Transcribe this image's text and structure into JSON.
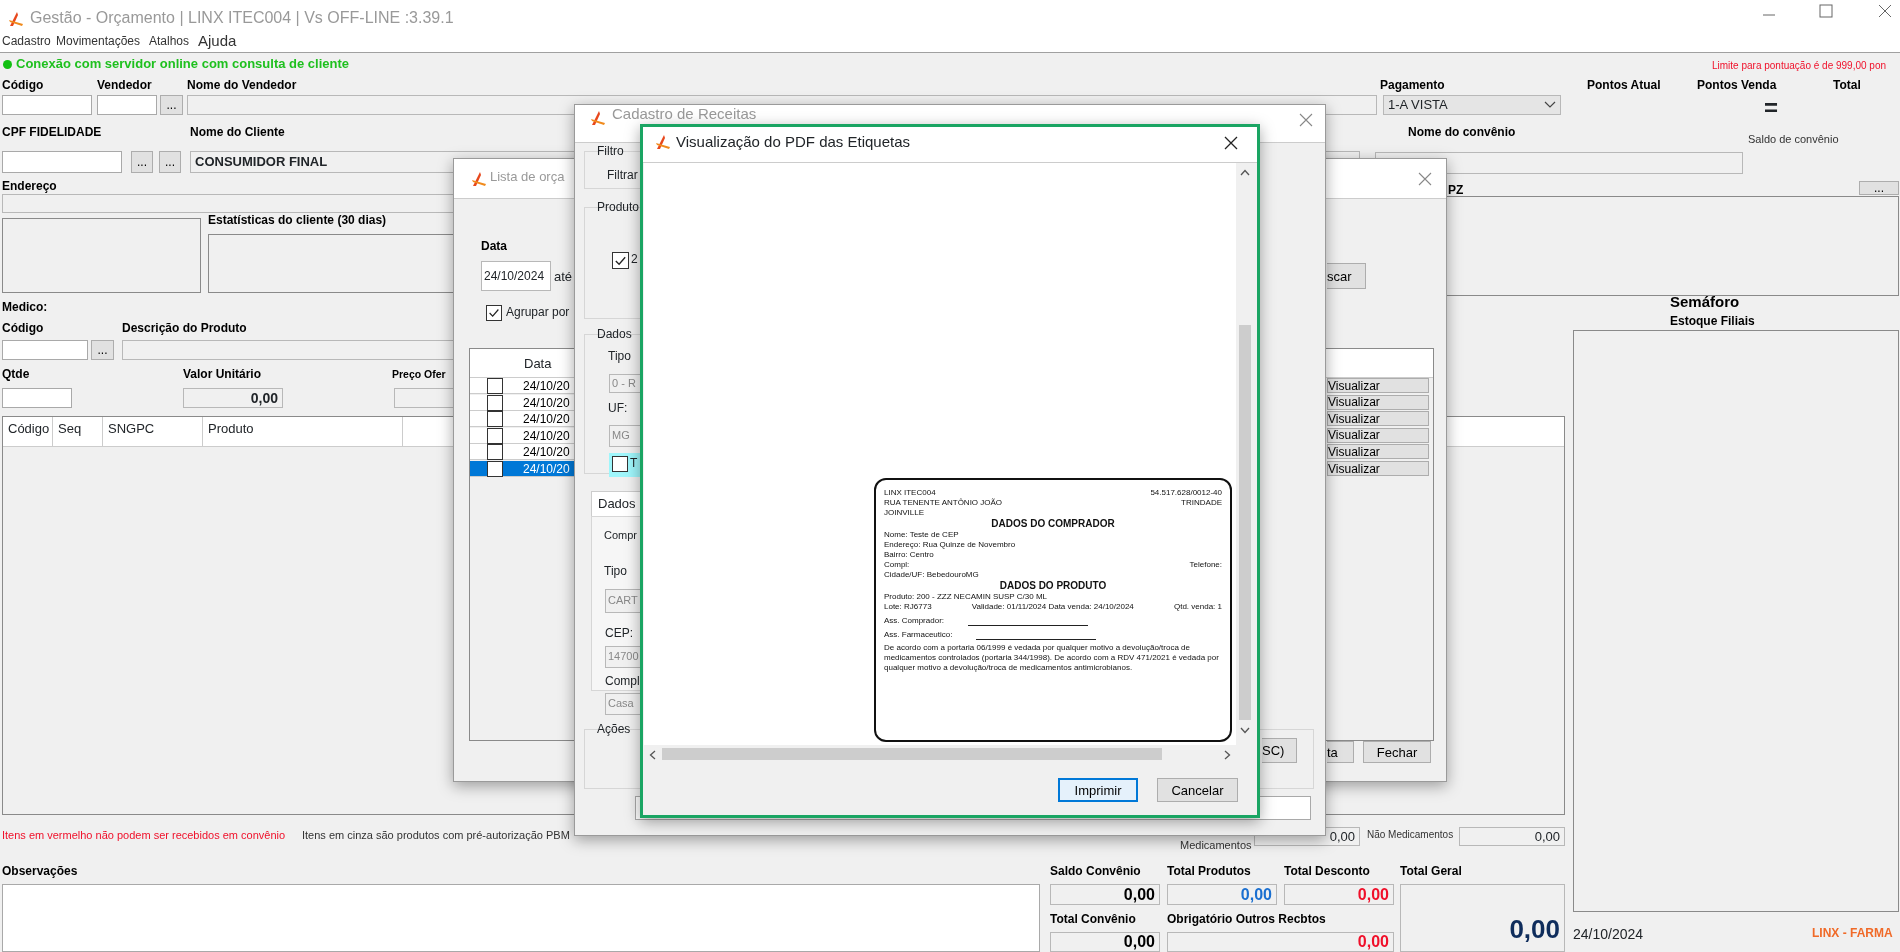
{
  "window": {
    "title": "Gestão - Orçamento  | LINX ITEC004 | Vs OFF-LINE :3.39.1"
  },
  "menu": [
    "Cadastro",
    "Movimentações",
    "Atalhos",
    "Ajuda"
  ],
  "connection_status": {
    "text": "Conexão com servidor online com consulta de cliente",
    "online": true
  },
  "points_limit": "Limite para pontuação é de 999,00 pon",
  "form": {
    "items": [
      {
        "kind": "label",
        "text": "Código"
      },
      {
        "kind": "label",
        "text": "Vendedor"
      },
      {
        "kind": "label",
        "text": "Nome do Vendedor"
      },
      {
        "kind": "label",
        "text": "Pagamento"
      },
      {
        "kind": "label",
        "text": "Pontos Atual"
      },
      {
        "kind": "label",
        "text": "Pontos Venda"
      },
      {
        "kind": "label",
        "text": "Total"
      },
      {
        "kind": "field"
      },
      {
        "kind": "field"
      },
      {
        "kind": "button",
        "text": "..."
      },
      {
        "kind": "readonly-field"
      },
      {
        "kind": "select",
        "text": "1-A VISTA"
      },
      {
        "kind": "sign",
        "text": "="
      },
      {
        "kind": "label",
        "text": "CPF FIDELIDADE"
      },
      {
        "kind": "label",
        "text": "Nome do Cliente"
      },
      {
        "kind": "label",
        "text": "Nome do convênio"
      },
      {
        "kind": "note",
        "text": "Saldo de convênio"
      },
      {
        "kind": "field"
      },
      {
        "kind": "button",
        "text": "..."
      },
      {
        "kind": "button",
        "text": "..."
      },
      {
        "kind": "name-field",
        "text": "CONSUMIDOR FINAL"
      },
      {
        "kind": "readonly-field"
      },
      {
        "kind": "label",
        "text": "Endereço"
      },
      {
        "kind": "readonly-field"
      },
      {
        "kind": "label",
        "text": "PZ"
      },
      {
        "kind": "button",
        "text": "..."
      },
      {
        "kind": "box"
      },
      {
        "kind": "label",
        "text": "Estatísticas do cliente  (30 dias)"
      },
      {
        "kind": "box"
      },
      {
        "kind": "box"
      },
      {
        "kind": "label",
        "text": "Medico:"
      },
      {
        "kind": "label",
        "text": "Código"
      },
      {
        "kind": "label",
        "text": "Descrição do Produto"
      },
      {
        "kind": "field"
      },
      {
        "kind": "button",
        "text": "..."
      },
      {
        "kind": "readonly-field"
      },
      {
        "kind": "label",
        "text": "Qtde"
      },
      {
        "kind": "label",
        "text": "Valor Unitário"
      },
      {
        "kind": "label",
        "text": "Preço Ofer"
      },
      {
        "kind": "field"
      },
      {
        "kind": "amount-field",
        "text": "0,00"
      },
      {
        "kind": "readonly-field"
      },
      {
        "kind": "heading",
        "text": "Semáforo"
      },
      {
        "kind": "label",
        "text": "Estoque Filiais"
      },
      {
        "kind": "box"
      },
      {
        "kind": "warning",
        "text": "Itens em vermelho não podem ser recebidos em convênio"
      },
      {
        "kind": "note",
        "text": "Itens em cinza são produtos com pré-autorização PBM"
      },
      {
        "kind": "note",
        "text": "Medicamentos"
      },
      {
        "kind": "number-field",
        "text": "0,00"
      },
      {
        "kind": "note",
        "text": "Não Medicamentos"
      },
      {
        "kind": "number-field",
        "text": "0,00"
      },
      {
        "kind": "label",
        "text": "Observações"
      },
      {
        "kind": "textarea"
      },
      {
        "kind": "plain",
        "text": "24/10/2024"
      },
      {
        "kind": "brand",
        "text": "LINX - FARMA"
      }
    ]
  },
  "items_grid": {
    "columns": [
      "Código",
      "Seq",
      "SNGPC",
      "Produto"
    ]
  },
  "totals": [
    {
      "label": "Saldo Convênio",
      "value": "0,00",
      "color": "#000000"
    },
    {
      "label": "Total Produtos",
      "value": "0,00",
      "color": "#1a6fd0"
    },
    {
      "label": "Total Desconto",
      "value": "0,00",
      "color": "#f0102a"
    },
    {
      "label": "Total Convênio",
      "value": "0,00",
      "color": "#000000"
    },
    {
      "label": "Obrigatório Outros Recbtos",
      "value": "0,00",
      "color": "#f0102a"
    }
  ],
  "grand_total": {
    "label": "Total Geral",
    "value": "0,00"
  },
  "lista_window": {
    "title": "Lista de orça",
    "date_label": "Data",
    "date_value": "24/10/2024",
    "until": "até",
    "group_checkbox": {
      "label": "Agrupar por",
      "checked": true
    },
    "search_button": "scar",
    "grid_header": "Data",
    "rows": [
      {
        "date": "24/10/20",
        "checked": false,
        "selected": false,
        "action": "Visualizar"
      },
      {
        "date": "24/10/20",
        "checked": false,
        "selected": false,
        "action": "Visualizar"
      },
      {
        "date": "24/10/20",
        "checked": false,
        "selected": false,
        "action": "Visualizar"
      },
      {
        "date": "24/10/20",
        "checked": false,
        "selected": false,
        "action": "Visualizar"
      },
      {
        "date": "24/10/20",
        "checked": false,
        "selected": false,
        "action": "Visualizar"
      },
      {
        "date": "24/10/20",
        "checked": false,
        "selected": true,
        "action": "Visualizar"
      }
    ],
    "buttons": [
      "ta",
      "Fechar"
    ]
  },
  "cadastro_window": {
    "title": "Cadastro de Receitas",
    "filter_group": "Filtro",
    "filter_label": "Filtrar",
    "product_group": "Produto",
    "product_check": {
      "label": "2",
      "checked": true
    },
    "data_group": "Dados",
    "type_label": "Tipo",
    "type_value": "0 - R",
    "uf_label": "UF:",
    "uf_value": "MG",
    "t_check": {
      "label": "T",
      "checked": false
    },
    "tab": "Dados",
    "buyer_label": "Compr",
    "doc_type_label": "Tipo",
    "doc_type_value": "CART",
    "cep_label": "CEP:",
    "cep_value": "14700",
    "compl_label": "Compl",
    "compl_value": "Casa",
    "actions_group": "Ações",
    "esc_button": "SC)"
  },
  "pdf_window": {
    "title": "Visualização do PDF das Etiquetas",
    "label_lines": [
      {
        "kind": "pair",
        "left": "LINX ITEC004",
        "right": "54.517.628/0012-40"
      },
      {
        "kind": "pair",
        "left": "RUA TENENTE ANTÔNIO JOÃO",
        "right": "TRINDADE"
      },
      {
        "kind": "text",
        "text": "JOINVILLE"
      },
      {
        "kind": "heading",
        "text": "DADOS DO COMPRADOR"
      },
      {
        "kind": "text",
        "text": "Nome: Teste de CEP"
      },
      {
        "kind": "text",
        "text": "Endereço: Rua Quinze de Novembro"
      },
      {
        "kind": "text",
        "text": "Bairro: Centro"
      },
      {
        "kind": "pair",
        "left": "Compl:",
        "right": "Telefone:"
      },
      {
        "kind": "text",
        "text": "Cidade/UF: BebedouroMG"
      },
      {
        "kind": "heading",
        "text": "DADOS DO PRODUTO"
      },
      {
        "kind": "text",
        "text": "Produto: 200 - ZZZ NECAMIN SUSP C/30 ML"
      },
      {
        "kind": "triple",
        "left": "Lote: RJ6773",
        "middle": "Validade: 01/11/2024  Data venda: 24/10/2024",
        "right": "Qtd. venda: 1"
      },
      {
        "kind": "sign",
        "text": "Ass. Comprador:"
      },
      {
        "kind": "sign",
        "text": "Ass. Farmaceutico:"
      },
      {
        "kind": "paragraph",
        "text": "De acordo com a portaria 06/1999 é vedada por qualquer motivo a devolução/troca de medicamentos controlados (portaria 344/1998). De acordo com a RDV 471/2021 é vedada por qualquer motivo a devolução/troca de medicamentos antimicrobianos."
      }
    ],
    "buttons": [
      {
        "label": "Imprimir",
        "focused": true
      },
      {
        "label": "Cancelar",
        "focused": false
      }
    ]
  }
}
